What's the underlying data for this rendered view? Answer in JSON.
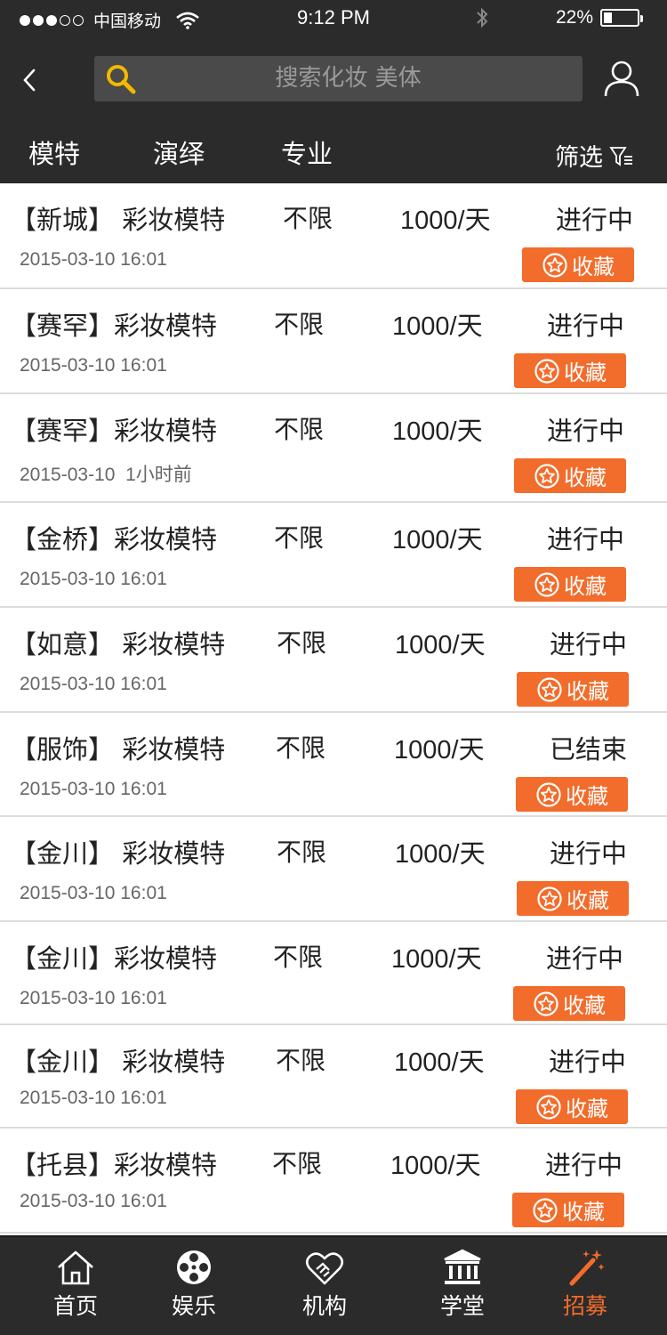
{
  "status_bar": {
    "carrier": "中国移动",
    "time": "9:12 PM",
    "battery": "22%"
  },
  "search": {
    "placeholder": "搜索化妆 美体"
  },
  "tabs": {
    "items": [
      {
        "label": "模特"
      },
      {
        "label": "演绎"
      },
      {
        "label": "专业"
      }
    ],
    "filter_label": "筛选"
  },
  "list": {
    "rows": [
      {
        "title": "【新城】 彩妆模特",
        "limit": "不限",
        "pay": "1000/天",
        "status": "进行中",
        "date": "2015-03-10 16:01",
        "fav_label": "收藏"
      },
      {
        "title": "【赛罕】彩妆模特",
        "limit": "不限",
        "pay": "1000/天",
        "status": "进行中",
        "date": "2015-03-10 16:01",
        "fav_label": "收藏"
      },
      {
        "title": "【赛罕】彩妆模特",
        "limit": "不限",
        "pay": "1000/天",
        "status": "进行中",
        "date": "2015-03-10  1小时前",
        "fav_label": "收藏"
      },
      {
        "title": "【金桥】彩妆模特",
        "limit": "不限",
        "pay": "1000/天",
        "status": "进行中",
        "date": "2015-03-10 16:01",
        "fav_label": "收藏"
      },
      {
        "title": "【如意】 彩妆模特",
        "limit": "不限",
        "pay": "1000/天",
        "status": "进行中",
        "date": "2015-03-10 16:01",
        "fav_label": "收藏"
      },
      {
        "title": "【服饰】 彩妆模特",
        "limit": "不限",
        "pay": "1000/天",
        "status": "已结束",
        "date": "2015-03-10 16:01",
        "fav_label": "收藏"
      },
      {
        "title": "【金川】 彩妆模特",
        "limit": "不限",
        "pay": "1000/天",
        "status": "进行中",
        "date": "2015-03-10 16:01",
        "fav_label": "收藏"
      },
      {
        "title": "【金川】彩妆模特",
        "limit": "不限",
        "pay": "1000/天",
        "status": "进行中",
        "date": "2015-03-10 16:01",
        "fav_label": "收藏"
      },
      {
        "title": "【金川】 彩妆模特",
        "limit": "不限",
        "pay": "1000/天",
        "status": "进行中",
        "date": "2015-03-10 16:01",
        "fav_label": "收藏"
      },
      {
        "title": "【托县】彩妆模特",
        "limit": "不限",
        "pay": "1000/天",
        "status": "进行中",
        "date": "2015-03-10 16:01",
        "fav_label": "收藏"
      }
    ]
  },
  "tabbar": {
    "items": [
      {
        "label": "首页",
        "icon": "home-icon"
      },
      {
        "label": "娱乐",
        "icon": "film-reel-icon"
      },
      {
        "label": "机构",
        "icon": "handshake-heart-icon"
      },
      {
        "label": "学堂",
        "icon": "institution-icon"
      },
      {
        "label": "招募",
        "icon": "magic-wand-icon"
      }
    ],
    "active_index": 4
  },
  "colors": {
    "header_bg": "#2b2b2b",
    "accent": "#f26c2b",
    "search_icon": "#f5b800"
  }
}
